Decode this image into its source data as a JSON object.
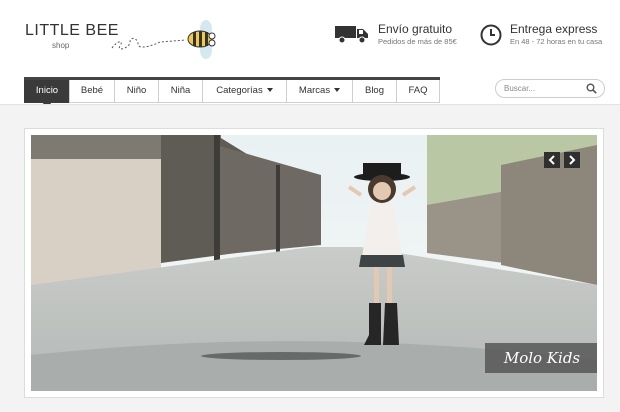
{
  "brand": {
    "name": "LITTLE BEE",
    "sub": "shop"
  },
  "features": [
    {
      "icon": "truck-icon",
      "title": "Envío gratuito",
      "subtitle": "Pedidos de más de 85€"
    },
    {
      "icon": "clock-icon",
      "title": "Entrega express",
      "subtitle": "En 48 - 72 horas en tu casa"
    }
  ],
  "nav": {
    "items": [
      {
        "label": "Inicio",
        "active": true
      },
      {
        "label": "Bebé"
      },
      {
        "label": "Niño"
      },
      {
        "label": "Niña"
      },
      {
        "label": "Categorías",
        "dropdown": true
      },
      {
        "label": "Marcas",
        "dropdown": true
      },
      {
        "label": "Blog"
      },
      {
        "label": "FAQ"
      }
    ]
  },
  "search": {
    "placeholder": "Buscar...",
    "icon": "search-icon"
  },
  "slider": {
    "caption": "Molo Kids",
    "prev_icon": "chevron-left-icon",
    "next_icon": "chevron-right-icon"
  }
}
